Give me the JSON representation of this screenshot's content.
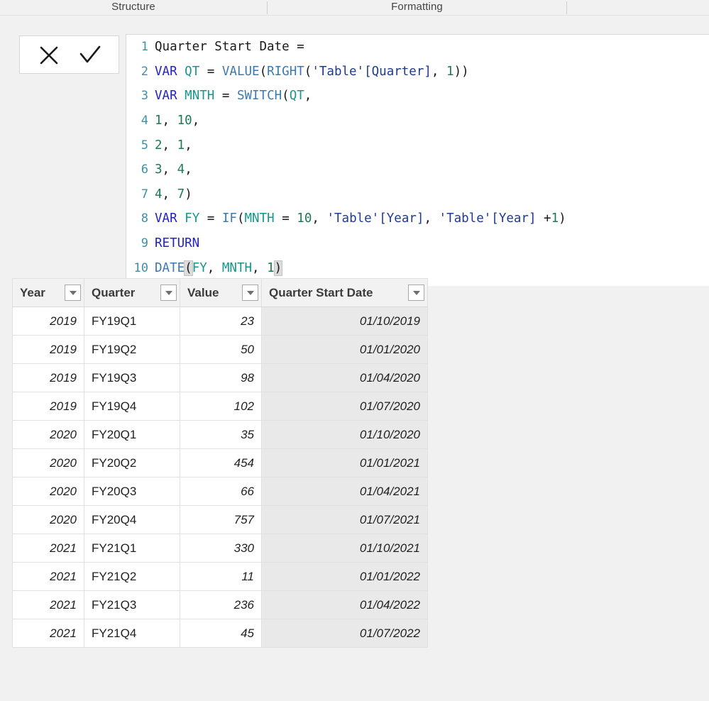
{
  "ribbon": {
    "groups": [
      {
        "label": "Structure"
      },
      {
        "label": "Formatting"
      }
    ]
  },
  "formula_bar": {
    "cancel_label": "✕",
    "commit_label": "✓",
    "cancel_name": "Cancel",
    "commit_name": "Commit",
    "measure_name": "Quarter Start Date",
    "lines": [
      {
        "n": "1",
        "text": "Quarter Start Date ="
      },
      {
        "n": "2",
        "text": "VAR QT = VALUE(RIGHT('Table'[Quarter], 1))"
      },
      {
        "n": "3",
        "text": "VAR MNTH = SWITCH(QT,"
      },
      {
        "n": "4",
        "text": "1, 10,"
      },
      {
        "n": "5",
        "text": "2, 1,"
      },
      {
        "n": "6",
        "text": "3, 4,"
      },
      {
        "n": "7",
        "text": "4, 7)"
      },
      {
        "n": "8",
        "text": "VAR FY = IF(MNTH = 10, 'Table'[Year], 'Table'[Year] +1)"
      },
      {
        "n": "9",
        "text": "RETURN"
      },
      {
        "n": "10",
        "text": "DATE(FY, MNTH, 1)"
      }
    ]
  },
  "table": {
    "columns": [
      {
        "label": "Year",
        "align": "num",
        "highlight": false
      },
      {
        "label": "Quarter",
        "align": "txt",
        "highlight": false
      },
      {
        "label": "Value",
        "align": "num",
        "highlight": false
      },
      {
        "label": "Quarter Start Date",
        "align": "calc",
        "highlight": true
      }
    ],
    "rows": [
      {
        "year": "2019",
        "quarter": "FY19Q1",
        "value": "23",
        "start": "01/10/2019"
      },
      {
        "year": "2019",
        "quarter": "FY19Q2",
        "value": "50",
        "start": "01/01/2020"
      },
      {
        "year": "2019",
        "quarter": "FY19Q3",
        "value": "98",
        "start": "01/04/2020"
      },
      {
        "year": "2019",
        "quarter": "FY19Q4",
        "value": "102",
        "start": "01/07/2020"
      },
      {
        "year": "2020",
        "quarter": "FY20Q1",
        "value": "35",
        "start": "01/10/2020"
      },
      {
        "year": "2020",
        "quarter": "FY20Q2",
        "value": "454",
        "start": "01/01/2021"
      },
      {
        "year": "2020",
        "quarter": "FY20Q3",
        "value": "66",
        "start": "01/04/2021"
      },
      {
        "year": "2020",
        "quarter": "FY20Q4",
        "value": "757",
        "start": "01/07/2021"
      },
      {
        "year": "2021",
        "quarter": "FY21Q1",
        "value": "330",
        "start": "01/10/2021"
      },
      {
        "year": "2021",
        "quarter": "FY21Q2",
        "value": "11",
        "start": "01/01/2022"
      },
      {
        "year": "2021",
        "quarter": "FY21Q3",
        "value": "236",
        "start": "01/04/2022"
      },
      {
        "year": "2021",
        "quarter": "FY21Q4",
        "value": "45",
        "start": "01/07/2022"
      }
    ]
  },
  "colors": {
    "highlight_header": "#edc200",
    "calc_column": "#e9e9e9",
    "header": "#f2f2f2",
    "page_background": "#f1f1f1",
    "keyword": "#2222c8",
    "variable": "#17968c",
    "function": "#3b79b4",
    "number": "#1f7a52",
    "reference": "#1f3a93",
    "line_number": "#3f8fa8"
  }
}
